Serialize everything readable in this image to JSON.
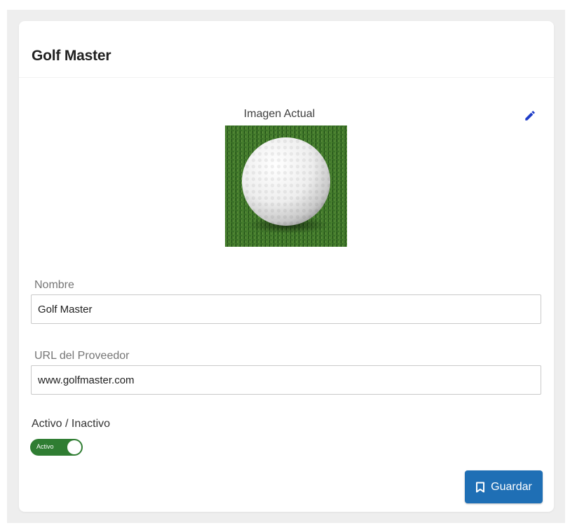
{
  "header": {
    "title": "Golf Master"
  },
  "image_section": {
    "label": "Imagen Actual",
    "edit_icon": "pencil-icon",
    "image_subject": "golf ball on grass"
  },
  "fields": {
    "nombre": {
      "label": "Nombre",
      "value": "Golf Master"
    },
    "url": {
      "label": "URL del Proveedor",
      "value": "www.golfmaster.com"
    }
  },
  "status": {
    "label": "Activo / Inactivo",
    "toggle_text": "Activo",
    "active": true
  },
  "actions": {
    "save_label": "Guardar",
    "save_icon": "bookmark-icon"
  },
  "colors": {
    "accent": "#1f6fb5",
    "toggle_on": "#2f7d32",
    "edit_icon": "#1e3cc8"
  }
}
